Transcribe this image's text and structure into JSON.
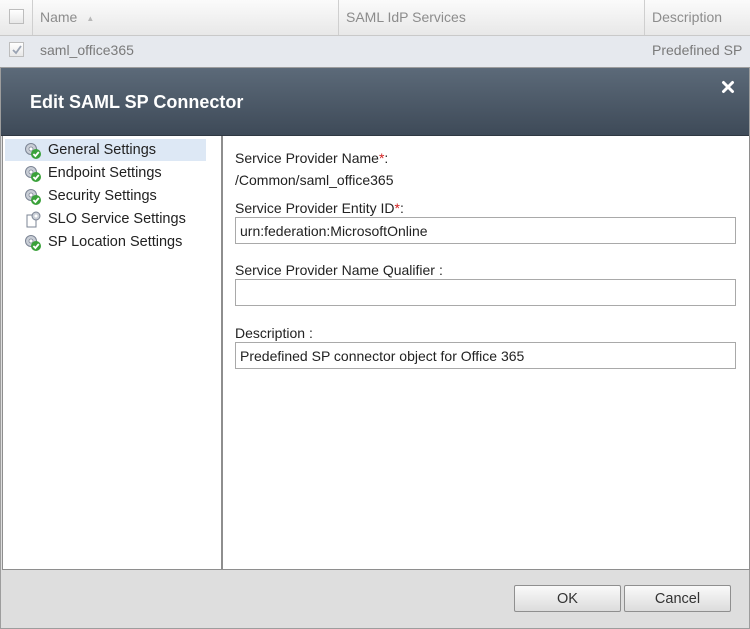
{
  "grid": {
    "columns": {
      "name": "Name",
      "saml_idp_services": "SAML IdP Services",
      "description": "Description"
    },
    "row": {
      "name": "saml_office365",
      "description": "Predefined SP"
    }
  },
  "dialog": {
    "title": "Edit SAML SP Connector",
    "nav": [
      {
        "label": "General Settings",
        "icon": "gear-check-icon"
      },
      {
        "label": "Endpoint Settings",
        "icon": "gear-check-icon"
      },
      {
        "label": "Security Settings",
        "icon": "gear-check-icon"
      },
      {
        "label": "SLO Service Settings",
        "icon": "gear-icon"
      },
      {
        "label": "SP Location Settings",
        "icon": "gear-check-icon"
      }
    ],
    "form": {
      "sp_name_label": "Service Provider Name",
      "sp_name_value": "/Common/saml_office365",
      "entity_id_label": "Service Provider Entity ID",
      "entity_id_value": "urn:federation:MicrosoftOnline",
      "name_qualifier_label": "Service Provider Name Qualifier",
      "name_qualifier_value": "",
      "description_label": "Description",
      "description_value": "Predefined SP connector object for Office 365",
      "required_marker": "*",
      "label_colon": ":"
    },
    "buttons": {
      "ok": "OK",
      "cancel": "Cancel"
    }
  },
  "colors": {
    "header_gradient_top": "#5c6a79",
    "header_gradient_bottom": "#3e4a58",
    "required": "#d21f1f",
    "nav_active": "#dde8f5"
  }
}
